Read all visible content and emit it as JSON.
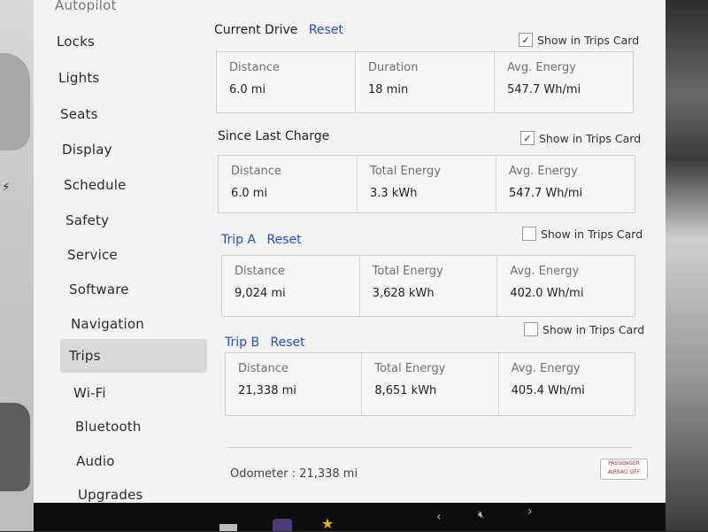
{
  "sidebar": {
    "items": [
      {
        "label": "Autopilot"
      },
      {
        "label": "Locks"
      },
      {
        "label": "Lights"
      },
      {
        "label": "Seats"
      },
      {
        "label": "Display"
      },
      {
        "label": "Schedule"
      },
      {
        "label": "Safety"
      },
      {
        "label": "Service"
      },
      {
        "label": "Software"
      },
      {
        "label": "Navigation"
      },
      {
        "label": "Trips"
      },
      {
        "label": "Wi-Fi"
      },
      {
        "label": "Bluetooth"
      },
      {
        "label": "Audio"
      },
      {
        "label": "Upgrades"
      }
    ],
    "active": "Trips"
  },
  "current_drive": {
    "title": "Current Drive",
    "reset": "Reset",
    "show_in_trips_card": {
      "label": "Show in Trips Card",
      "checked": true
    },
    "cells": [
      {
        "label": "Distance",
        "value": "6.0 mi"
      },
      {
        "label": "Duration",
        "value": "18 min"
      },
      {
        "label": "Avg. Energy",
        "value": "547.7 Wh/mi"
      }
    ]
  },
  "since_last_charge": {
    "title": "Since Last Charge",
    "show_in_trips_card": {
      "label": "Show in Trips Card",
      "checked": true
    },
    "cells": [
      {
        "label": "Distance",
        "value": "6.0 mi"
      },
      {
        "label": "Total Energy",
        "value": "3.3 kWh"
      },
      {
        "label": "Avg. Energy",
        "value": "547.7 Wh/mi"
      }
    ]
  },
  "trip_a": {
    "title": "Trip A",
    "reset": "Reset",
    "show_in_trips_card": {
      "label": "Show in Trips Card",
      "checked": false
    },
    "cells": [
      {
        "label": "Distance",
        "value": "9,024 mi"
      },
      {
        "label": "Total Energy",
        "value": "3,628 kWh"
      },
      {
        "label": "Avg. Energy",
        "value": "402.0 Wh/mi"
      }
    ]
  },
  "trip_b": {
    "title": "Trip B",
    "reset": "Reset",
    "show_in_trips_card": {
      "label": "Show in Trips Card",
      "checked": false
    },
    "cells": [
      {
        "label": "Distance",
        "value": "21,338 mi"
      },
      {
        "label": "Total Energy",
        "value": "8,651 kWh"
      },
      {
        "label": "Avg. Energy",
        "value": "405.4 Wh/mi"
      }
    ]
  },
  "odometer": "Odometer : 21,338 mi",
  "airbag_badge": {
    "line1": "PASSENGER",
    "line2": "AIRBAG OFF"
  },
  "taskbar": {
    "left_chevron": "‹",
    "right_chevron": "›",
    "mute_icon": "🔇︎"
  },
  "colors": {
    "link": "#1f4fd6",
    "active_bg": "#d9d9d9",
    "panel_bg": "#f3f3f3"
  }
}
